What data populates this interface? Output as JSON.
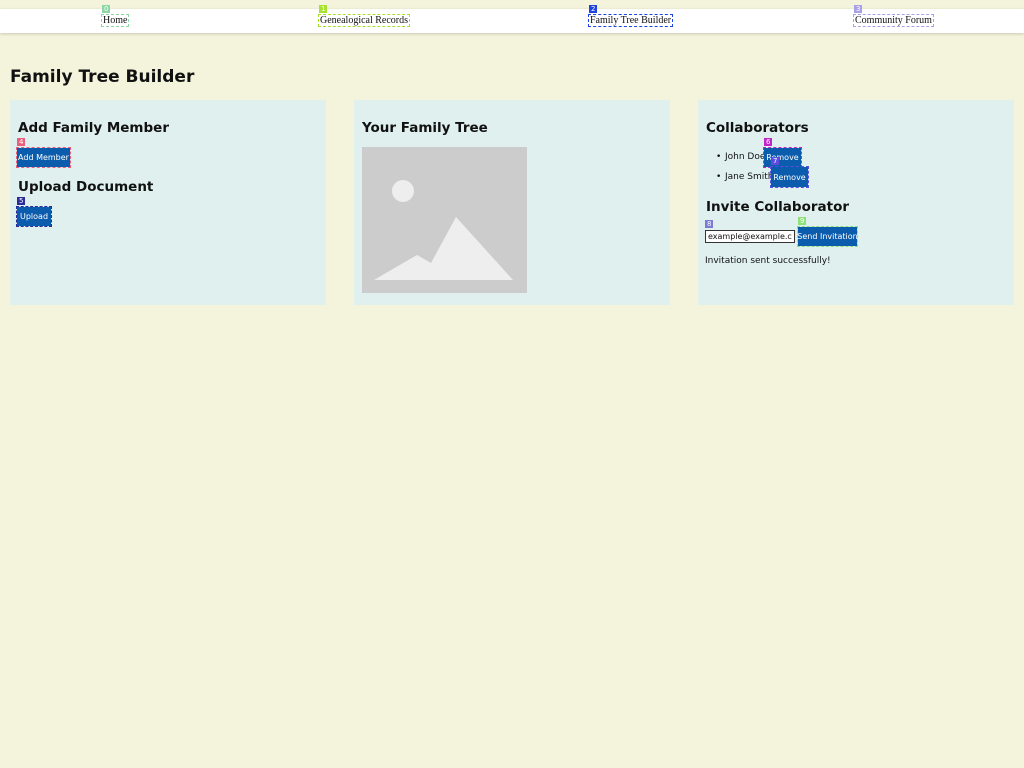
{
  "nav": {
    "items": [
      {
        "label": "Home",
        "mark": "0",
        "mark_color": "#8fd6a6"
      },
      {
        "label": "Genealogical Records",
        "mark": "1",
        "mark_color": "#a6e22e"
      },
      {
        "label": "Family Tree Builder",
        "mark": "2",
        "mark_color": "#1f45e0"
      },
      {
        "label": "Community Forum",
        "mark": "3",
        "mark_color": "#a9a1e6"
      }
    ]
  },
  "page_title": "Family Tree Builder",
  "add_panel": {
    "add_heading": "Add Family Member",
    "add_button": "Add Member",
    "add_mark": "4",
    "add_mark_color": "#e8607e",
    "upload_heading": "Upload Document",
    "upload_button": "Upload",
    "upload_mark": "5",
    "upload_mark_color": "#2b2b9a"
  },
  "tree_panel": {
    "heading": "Your Family Tree",
    "image_icon": "image-placeholder-icon"
  },
  "collab_panel": {
    "heading": "Collaborators",
    "collaborators": [
      {
        "name": "John Doe",
        "remove_label": "Remove",
        "mark": "6",
        "mark_color": "#c026c9"
      },
      {
        "name": "Jane Smith",
        "remove_label": "Remove",
        "mark": "7",
        "mark_color": "#5b4de0"
      }
    ],
    "invite_heading": "Invite Collaborator",
    "email_value": "example@example.com",
    "email_mark": "8",
    "email_mark_color": "#7b7bd6",
    "send_button": "Send Invitation",
    "send_mark": "9",
    "send_mark_color": "#8fe07a",
    "status_message": "Invitation sent successfully!"
  },
  "colors": {
    "page_bg": "#f4f4dc",
    "panel_bg": "#dff0ee",
    "button_bg": "#0b5cad",
    "navbar_bg": "#ffffff"
  }
}
